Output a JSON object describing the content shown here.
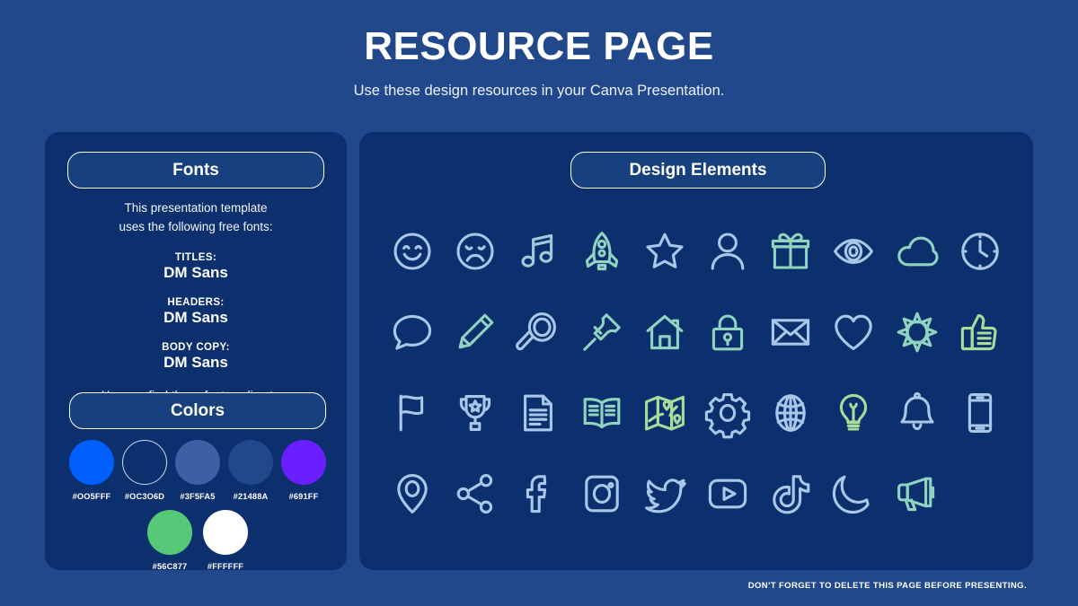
{
  "header": {
    "title": "RESOURCE PAGE",
    "subtitle": "Use these design resources in your Canva Presentation."
  },
  "fonts_panel": {
    "pill_label": "Fonts",
    "intro_line_1": "This presentation template",
    "intro_line_2": "uses the following free fonts:",
    "groups": [
      {
        "role": "TITLES:",
        "font": "DM Sans"
      },
      {
        "role": "HEADERS:",
        "font": "DM Sans"
      },
      {
        "role": "BODY COPY:",
        "font": "DM Sans"
      }
    ],
    "footnote": "You can find these fonts online too."
  },
  "colors_panel": {
    "pill_label": "Colors",
    "row_1": [
      {
        "hex": "#005FFF",
        "label": "#OO5FFF",
        "outlined": false
      },
      {
        "hex": "#0C306D",
        "label": "#OC3O6D",
        "outlined": true
      },
      {
        "hex": "#3F5FA5",
        "label": "#3F5FA5",
        "outlined": false
      },
      {
        "hex": "#21488A",
        "label": "#21488A",
        "outlined": false
      },
      {
        "hex": "#691FFF",
        "label": "#691FF",
        "outlined": false
      }
    ],
    "row_2": [
      {
        "hex": "#56C877",
        "label": "#56C877",
        "outlined": false
      },
      {
        "hex": "#FFFFFF",
        "label": "#FFFFFF",
        "outlined": false
      }
    ]
  },
  "elements_panel": {
    "pill_label": "Design Elements",
    "icons": [
      {
        "name": "smiley-face-icon",
        "stroke": "#A9C7E8"
      },
      {
        "name": "sad-face-icon",
        "stroke": "#A9C7E8"
      },
      {
        "name": "music-note-icon",
        "stroke": "#9FCBD8"
      },
      {
        "name": "rocket-icon",
        "stroke": "#8FD3C0"
      },
      {
        "name": "star-icon",
        "stroke": "#A9C7E8"
      },
      {
        "name": "person-icon",
        "stroke": "#A9C7E8"
      },
      {
        "name": "gift-icon",
        "stroke": "#8FD3C0"
      },
      {
        "name": "eye-icon",
        "stroke": "#A9C7E8"
      },
      {
        "name": "cloud-icon",
        "stroke": "#8FD3C0"
      },
      {
        "name": "clock-icon",
        "stroke": "#A9C7E8"
      },
      {
        "name": "speech-bubble-icon",
        "stroke": "#A9C7E8"
      },
      {
        "name": "pencil-icon",
        "stroke": "#8FD3C0"
      },
      {
        "name": "magnifier-icon",
        "stroke": "#A9C7E8"
      },
      {
        "name": "pushpin-icon",
        "stroke": "#8FD3C0"
      },
      {
        "name": "house-icon",
        "stroke": "#8FD3C0"
      },
      {
        "name": "lock-icon",
        "stroke": "#8FD3C0"
      },
      {
        "name": "envelope-icon",
        "stroke": "#A9C7E8"
      },
      {
        "name": "heart-icon",
        "stroke": "#A9C7E8"
      },
      {
        "name": "sun-icon",
        "stroke": "#8FD3C0"
      },
      {
        "name": "thumbs-up-icon",
        "stroke": "#A9DB9A"
      },
      {
        "name": "flag-icon",
        "stroke": "#A9C7E8"
      },
      {
        "name": "trophy-icon",
        "stroke": "#A9C7E8"
      },
      {
        "name": "document-icon",
        "stroke": "#A9C7E8"
      },
      {
        "name": "open-book-icon",
        "stroke": "#8FD3C0"
      },
      {
        "name": "map-icon",
        "stroke": "#A9DB9A"
      },
      {
        "name": "gear-icon",
        "stroke": "#A9C7E8"
      },
      {
        "name": "globe-icon",
        "stroke": "#A9C7E8"
      },
      {
        "name": "lightbulb-icon",
        "stroke": "#A9DB9A"
      },
      {
        "name": "bell-icon",
        "stroke": "#A9C7E8"
      },
      {
        "name": "phone-icon",
        "stroke": "#A9C7E8"
      },
      {
        "name": "location-pin-icon",
        "stroke": "#A9C7E8"
      },
      {
        "name": "share-icon",
        "stroke": "#A9C7E8"
      },
      {
        "name": "facebook-icon",
        "stroke": "#A9C7E8"
      },
      {
        "name": "instagram-icon",
        "stroke": "#A9C7E8"
      },
      {
        "name": "twitter-icon",
        "stroke": "#A9C7E8"
      },
      {
        "name": "youtube-icon",
        "stroke": "#A9C7E8"
      },
      {
        "name": "tiktok-icon",
        "stroke": "#A9C7E8"
      },
      {
        "name": "moon-icon",
        "stroke": "#A9C7E8"
      },
      {
        "name": "megaphone-icon",
        "stroke": "#8FD3C0"
      }
    ]
  },
  "footer": {
    "note": "DON'T FORGET TO DELETE THIS PAGE BEFORE PRESENTING."
  },
  "theme": {
    "background": "#21488A",
    "panel": "#0C306D",
    "text": "#FFFFFF"
  }
}
